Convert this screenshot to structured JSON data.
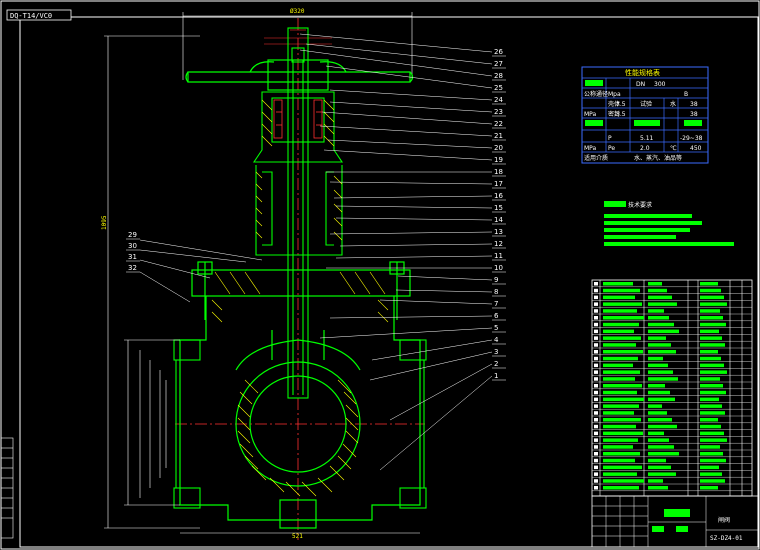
{
  "title_tab": "DQ-T14/VC0",
  "dims": {
    "top_width": "Ø320",
    "height": "1095",
    "bottom_width": "521"
  },
  "balloons_right": [
    "26",
    "27",
    "28",
    "25",
    "24",
    "23",
    "22",
    "21",
    "20",
    "19",
    "18",
    "17",
    "16",
    "15",
    "14",
    "13",
    "12",
    "11",
    "10",
    "9",
    "8",
    "7",
    "6",
    "5",
    "4",
    "3",
    "2",
    "1"
  ],
  "balloons_left": [
    "29",
    "30",
    "31",
    "32"
  ],
  "spec_table": {
    "title": "性能规格表",
    "rows": [
      [
        "",
        "DN",
        "300"
      ],
      [
        "公称通径",
        "Mpa",
        "B"
      ],
      [
        "",
        "壳体",
        "7.5",
        "试验",
        "水",
        "38"
      ],
      [
        "MPa",
        "密封",
        "5.5",
        "",
        "",
        "38"
      ],
      [
        "",
        "",
        "",
        "",
        "",
        ""
      ],
      [
        "",
        "P",
        "5.11",
        "",
        "",
        "-29~38"
      ],
      [
        "MPa",
        "Pe",
        "2.0",
        "",
        "℃",
        "450"
      ],
      [
        "适用介质",
        "水、蒸汽、油品等"
      ]
    ]
  },
  "tech_req": {
    "title": "技术要求"
  },
  "title_block": {
    "name": "闸阀",
    "code": "SZ-DZ4-01"
  }
}
